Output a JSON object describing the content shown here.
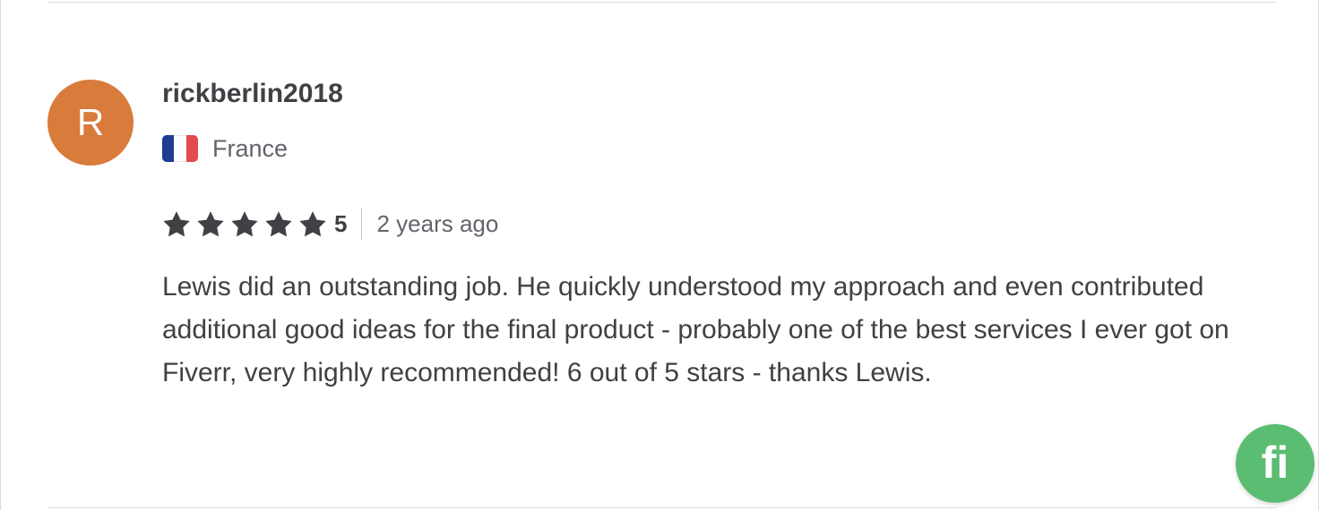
{
  "reviewer": {
    "avatar_letter": "R",
    "avatar_color": "#d97b3b",
    "username": "rickberlin2018",
    "country": "France",
    "flag_icon": "france-flag-icon"
  },
  "rating": {
    "stars": 5,
    "max_stars": 5,
    "score_label": "5",
    "time_ago": "2 years ago"
  },
  "review_text": "Lewis did an outstanding job. He quickly understood my approach and even contributed additional good ideas for the final product - probably one of the best services I ever got on Fiverr, very highly recommended! 6 out of 5 stars - thanks Lewis.",
  "chat_button": {
    "icon": "fiverr-logo-icon",
    "color": "#5bbd72"
  }
}
